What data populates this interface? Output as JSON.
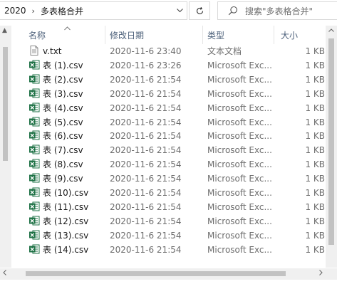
{
  "address": {
    "crumbs": [
      "2020",
      "多表格合并"
    ],
    "separator": "›",
    "dropdown_icon": "chevron-down-icon"
  },
  "search": {
    "placeholder": "搜索\"多表格合并\""
  },
  "columns": {
    "name": "名称",
    "date": "修改日期",
    "type": "类型",
    "size": "大小"
  },
  "colors": {
    "header_text": "#4c607a",
    "excel_green": "#1e7145",
    "muted_text": "#6d6d6d"
  },
  "files": [
    {
      "name": "v.txt",
      "icon": "text-file-icon",
      "date": "2020-11-6 23:40",
      "type": "文本文档",
      "size": "1 KB"
    },
    {
      "name": "表 (1).csv",
      "icon": "excel-csv-icon",
      "date": "2020-11-6 23:26",
      "type": "Microsoft Exc...",
      "size": "1 KB"
    },
    {
      "name": "表 (2).csv",
      "icon": "excel-csv-icon",
      "date": "2020-11-6 21:54",
      "type": "Microsoft Exc...",
      "size": "1 KB"
    },
    {
      "name": "表 (3).csv",
      "icon": "excel-csv-icon",
      "date": "2020-11-6 21:54",
      "type": "Microsoft Exc...",
      "size": "1 KB"
    },
    {
      "name": "表 (4).csv",
      "icon": "excel-csv-icon",
      "date": "2020-11-6 21:54",
      "type": "Microsoft Exc...",
      "size": "1 KB"
    },
    {
      "name": "表 (5).csv",
      "icon": "excel-csv-icon",
      "date": "2020-11-6 21:54",
      "type": "Microsoft Exc...",
      "size": "1 KB"
    },
    {
      "name": "表 (6).csv",
      "icon": "excel-csv-icon",
      "date": "2020-11-6 21:54",
      "type": "Microsoft Exc...",
      "size": "1 KB"
    },
    {
      "name": "表 (7).csv",
      "icon": "excel-csv-icon",
      "date": "2020-11-6 21:54",
      "type": "Microsoft Exc...",
      "size": "1 KB"
    },
    {
      "name": "表 (8).csv",
      "icon": "excel-csv-icon",
      "date": "2020-11-6 21:54",
      "type": "Microsoft Exc...",
      "size": "1 KB"
    },
    {
      "name": "表 (9).csv",
      "icon": "excel-csv-icon",
      "date": "2020-11-6 21:54",
      "type": "Microsoft Exc...",
      "size": "1 KB"
    },
    {
      "name": "表 (10).csv",
      "icon": "excel-csv-icon",
      "date": "2020-11-6 21:54",
      "type": "Microsoft Exc...",
      "size": "1 KB"
    },
    {
      "name": "表 (11).csv",
      "icon": "excel-csv-icon",
      "date": "2020-11-6 21:54",
      "type": "Microsoft Exc...",
      "size": "1 KB"
    },
    {
      "name": "表 (12).csv",
      "icon": "excel-csv-icon",
      "date": "2020-11-6 21:54",
      "type": "Microsoft Exc...",
      "size": "1 KB"
    },
    {
      "name": "表 (13).csv",
      "icon": "excel-csv-icon",
      "date": "2020-11-6 21:54",
      "type": "Microsoft Exc...",
      "size": "1 KB"
    },
    {
      "name": "表 (14).csv",
      "icon": "excel-csv-icon",
      "date": "2020-11-6 21:54",
      "type": "Microsoft Exc...",
      "size": "1 KB"
    }
  ]
}
